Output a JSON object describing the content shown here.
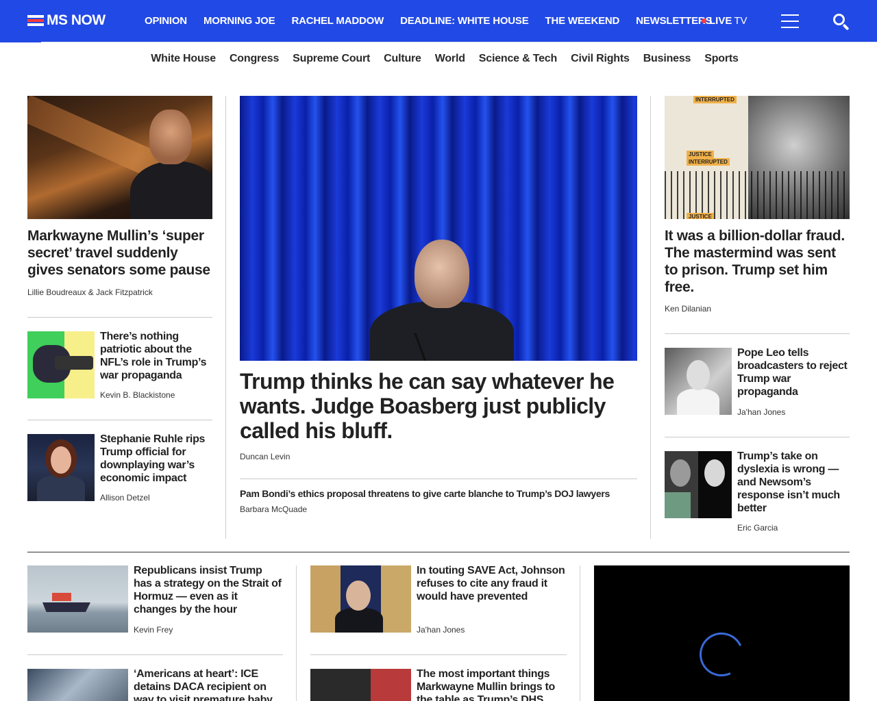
{
  "brand": {
    "name": "MS NOW"
  },
  "topnav": {
    "items": [
      "OPINION",
      "MORNING JOE",
      "RACHEL MADDOW",
      "DEADLINE: WHITE HOUSE",
      "THE WEEKEND",
      "NEWSLETTERS"
    ],
    "live_label": "LIVE",
    "live_tv": "TV"
  },
  "subnav": {
    "items": [
      "White House",
      "Congress",
      "Supreme Court",
      "Culture",
      "World",
      "Science & Tech",
      "Civil Rights",
      "Business",
      "Sports"
    ]
  },
  "left": {
    "lead": {
      "headline": "Markwayne Mullin’s ‘super secret’ travel suddenly gives senators some pause",
      "byline": "Lillie Boudreaux & Jack Fitzpatrick"
    },
    "stories": [
      {
        "headline": "There’s nothing patriotic about the NFL’s role in Trump’s war propaganda",
        "byline": "Kevin B. Blackistone"
      },
      {
        "headline": "Stephanie Ruhle rips Trump official for downplaying war’s economic impact",
        "byline": "Allison Detzel"
      }
    ]
  },
  "center": {
    "hero": {
      "headline": "Trump thinks he can say whatever he wants. Judge Boasberg just publicly called his bluff.",
      "byline": "Duncan Levin"
    },
    "secondary": {
      "headline": "Pam Bondi’s ethics proposal threatens to give carte blanche to Trump’s DOJ lawyers",
      "byline": "Barbara McQuade"
    }
  },
  "right": {
    "lead": {
      "headline": "It was a billion-dollar fraud. The mastermind was sent to prison. Trump set him free.",
      "byline": "Ken Dilanian"
    },
    "image_text": [
      "INTERRUPTED",
      "JUSTICE",
      "INTERRUPTED",
      "JUSTICE"
    ],
    "stories": [
      {
        "headline": "Pope Leo tells broadcasters to reject Trump war propaganda",
        "byline": "Ja'han Jones"
      },
      {
        "headline": "Trump’s take on dyslexia is wrong — and Newsom’s response isn’t much better",
        "byline": "Eric Garcia"
      }
    ]
  },
  "bottom": {
    "col1": [
      {
        "headline": "Republicans insist Trump has a strategy on the Strait of Hormuz — even as it changes by the hour",
        "byline": "Kevin Frey"
      },
      {
        "headline": "‘Americans at heart’: ICE detains DACA recipient on way to visit premature baby",
        "byline": ""
      }
    ],
    "col2": [
      {
        "headline": "In touting SAVE Act, Johnson refuses to cite any fraud it would have prevented",
        "byline": "Ja'han Jones"
      },
      {
        "headline": "The most important things Markwayne Mullin brings to the table as Trump’s DHS",
        "byline": ""
      }
    ]
  },
  "colors": {
    "brand_blue": "#2149e6",
    "live_red": "#ff3b3b"
  }
}
